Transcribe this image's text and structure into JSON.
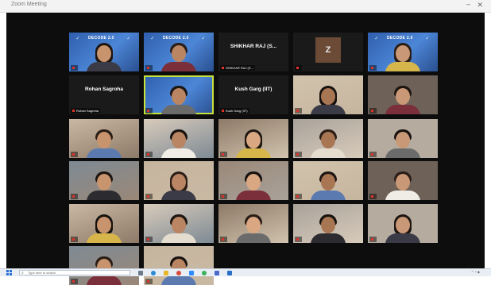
{
  "window": {
    "title": "Zoom Meeting",
    "close_glyph": "✕",
    "minimize_glyph": "–"
  },
  "participants": [
    {
      "name": "",
      "kind": "banner",
      "banner": "DECODE 2.0"
    },
    {
      "name": "",
      "kind": "banner",
      "banner": "DECODE 2.0"
    },
    {
      "name": "SHIKHAR RAJ (S...",
      "kind": "nametile"
    },
    {
      "name": "",
      "kind": "avatar",
      "initial": "Z"
    },
    {
      "name": "",
      "kind": "banner",
      "banner": "DECODE 2.0"
    },
    {
      "name": "Rohan Sagroha",
      "kind": "nametile"
    },
    {
      "name": "",
      "kind": "banner-active",
      "banner": ""
    },
    {
      "name": "Kush Garg (IIT)",
      "kind": "nametile"
    },
    {
      "name": "",
      "kind": "video"
    },
    {
      "name": "",
      "kind": "video"
    },
    {
      "name": "",
      "kind": "video"
    },
    {
      "name": "",
      "kind": "video"
    },
    {
      "name": "",
      "kind": "video"
    },
    {
      "name": "",
      "kind": "video"
    },
    {
      "name": "",
      "kind": "video"
    },
    {
      "name": "",
      "kind": "video"
    },
    {
      "name": "",
      "kind": "video"
    },
    {
      "name": "",
      "kind": "video"
    },
    {
      "name": "",
      "kind": "video"
    },
    {
      "name": "",
      "kind": "video"
    },
    {
      "name": "",
      "kind": "video"
    },
    {
      "name": "",
      "kind": "video"
    },
    {
      "name": "",
      "kind": "video"
    },
    {
      "name": "",
      "kind": "video"
    },
    {
      "name": "",
      "kind": "video"
    },
    {
      "name": "",
      "kind": "video"
    },
    {
      "name": "",
      "kind": "video"
    }
  ],
  "taskbar": {
    "search_placeholder": "Type here to search",
    "search_icon": "search-icon",
    "start_icon": "windows-start-icon"
  },
  "colors": {
    "stage": "#0d0d0d",
    "banner_blue": "#3e72c0",
    "active_border": "#c8e33a",
    "mic_muted": "#e0302a",
    "avatar_bg": "#6b4a36"
  }
}
